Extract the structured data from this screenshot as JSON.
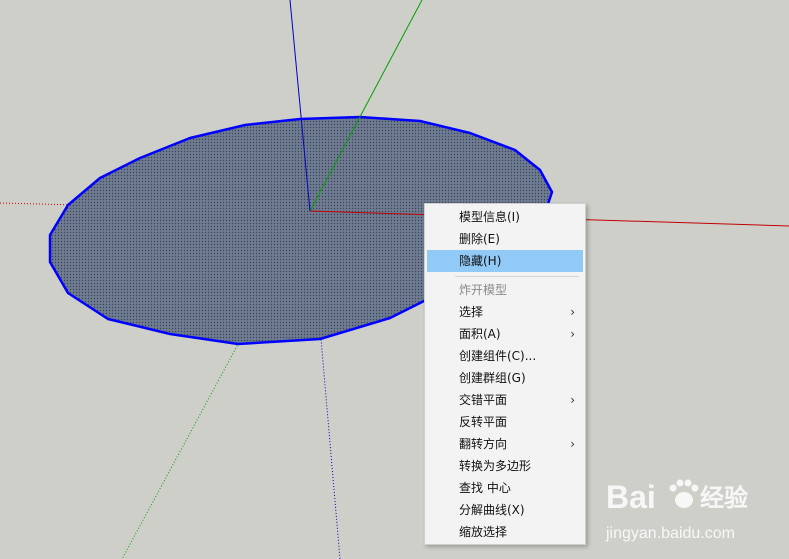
{
  "context_menu": {
    "items": [
      {
        "label": "模型信息(I)",
        "state": "normal",
        "submenu": false
      },
      {
        "label": "删除(E)",
        "state": "normal",
        "submenu": false
      },
      {
        "label": "隐藏(H)",
        "state": "highlighted",
        "submenu": false
      },
      {
        "label": "炸开模型",
        "state": "disabled",
        "submenu": false
      },
      {
        "label": "选择",
        "state": "normal",
        "submenu": true
      },
      {
        "label": "面积(A)",
        "state": "normal",
        "submenu": true
      },
      {
        "label": "创建组件(C)...",
        "state": "normal",
        "submenu": false
      },
      {
        "label": "创建群组(G)",
        "state": "normal",
        "submenu": false
      },
      {
        "label": "交错平面",
        "state": "normal",
        "submenu": true
      },
      {
        "label": "反转平面",
        "state": "normal",
        "submenu": false
      },
      {
        "label": "翻转方向",
        "state": "normal",
        "submenu": true
      },
      {
        "label": "转换为多边形",
        "state": "normal",
        "submenu": false
      },
      {
        "label": "查找 中心",
        "state": "normal",
        "submenu": false
      },
      {
        "label": "分解曲线(X)",
        "state": "normal",
        "submenu": false
      },
      {
        "label": "缩放选择",
        "state": "normal",
        "submenu": false
      }
    ],
    "submenu_arrow": "›"
  },
  "watermark": {
    "brand_left": "Bai",
    "brand_right": "经验",
    "url": "jingyan.baidu.com"
  },
  "colors": {
    "background": "#cfcfca",
    "face_fill": "#6d7a8e",
    "face_edge": "#0000ff",
    "axis_red": "#c00000",
    "axis_green": "#00a000",
    "axis_blue": "#0000c8",
    "menu_highlight": "#91c9f7"
  }
}
